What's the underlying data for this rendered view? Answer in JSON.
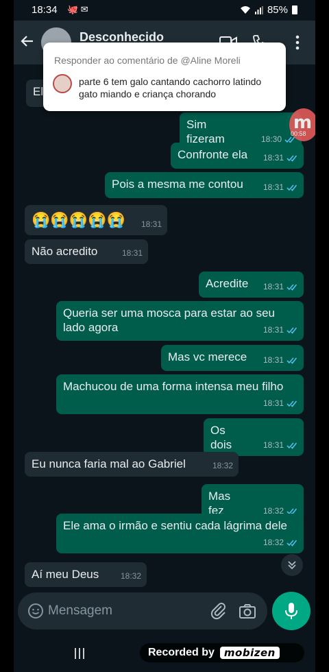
{
  "status_bar": {
    "time": "18:34",
    "icons": "🐙 ✉",
    "battery": "85%"
  },
  "header": {
    "contact_name": "Desconhecido"
  },
  "reply_popup": {
    "title": "Responder ao comentário de @Aline Moreli",
    "comment": "parte 6 tem galo cantando cachorro latindo gato miando e criança chorando"
  },
  "messages": [
    {
      "dir": "in",
      "text": "Ele",
      "time": ""
    },
    {
      "dir": "out",
      "text": "Sim fizeram",
      "time": "18:30"
    },
    {
      "dir": "out",
      "text": "Confronte ela",
      "time": "18:31"
    },
    {
      "dir": "out",
      "text": "Pois a mesma me contou",
      "time": "18:31"
    },
    {
      "dir": "in",
      "text": "😭😭😭😭😭",
      "time": "18:31"
    },
    {
      "dir": "in",
      "text": "Não acredito",
      "time": "18:31"
    },
    {
      "dir": "out",
      "text": "Acredite",
      "time": "18:31"
    },
    {
      "dir": "out",
      "text": "Queria ser uma mosca para estar ao seu lado agora",
      "time": "18:31"
    },
    {
      "dir": "out",
      "text": "Mas vc merece",
      "time": "18:31"
    },
    {
      "dir": "out",
      "text": "Machucou de uma forma intensa meu filho",
      "time": "18:31"
    },
    {
      "dir": "out",
      "text": "Os dois",
      "time": "18:31"
    },
    {
      "dir": "in",
      "text": "Eu nunca faria mal ao Gabriel",
      "time": "18:32"
    },
    {
      "dir": "out",
      "text": "Mas fez",
      "time": "18:32"
    },
    {
      "dir": "out",
      "text": "Ele ama o irmão e sentiu cada lágrima dele",
      "time": "18:32"
    },
    {
      "dir": "in",
      "text": "Aí meu Deus",
      "time": "18:32"
    }
  ],
  "recording_badge": {
    "letter": "m",
    "timer": "00:58"
  },
  "input": {
    "placeholder": "Mensagem"
  },
  "watermark": {
    "text": "Recorded by",
    "logo": "mobizen"
  },
  "colors": {
    "background": "#0b141a",
    "incoming": "#202c33",
    "outgoing": "#005c4b",
    "accent": "#00a884",
    "read_tick": "#53bdeb"
  }
}
